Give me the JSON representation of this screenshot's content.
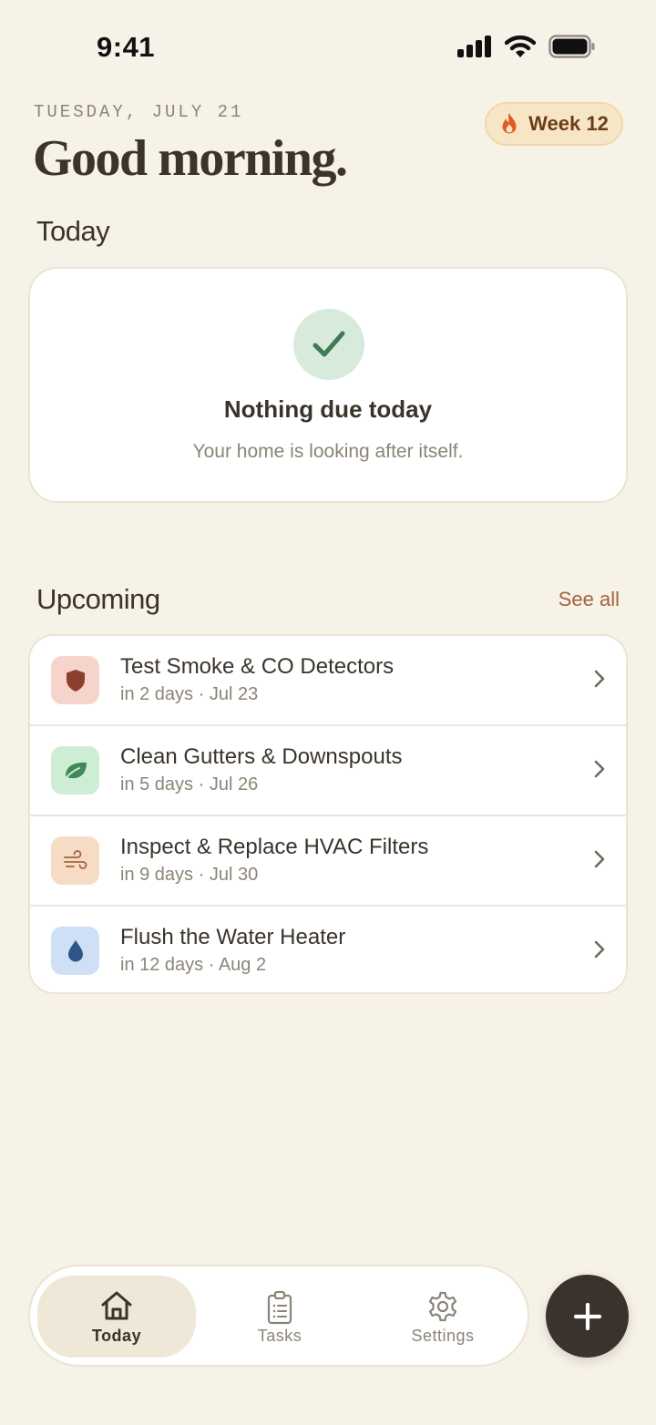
{
  "status_bar": {
    "time": "9:41"
  },
  "header": {
    "date": "TUESDAY, JULY 21",
    "greeting": "Good morning.",
    "streak_badge": {
      "label": "Week 12",
      "icon": "flame-icon"
    }
  },
  "today": {
    "title": "Today",
    "empty_headline": "Nothing due today",
    "empty_subtext": "Your home is looking after itself.",
    "icon": "check-icon"
  },
  "upcoming": {
    "title": "Upcoming",
    "see_all_label": "See all",
    "tasks": [
      {
        "title": "Test Smoke & CO Detectors",
        "due": "in 2 days · Jul 23",
        "icon": "shield-icon",
        "icon_bg": "#f6d4cc",
        "icon_color": "#8c3f2c"
      },
      {
        "title": "Clean Gutters & Downspouts",
        "due": "in 5 days · Jul 26",
        "icon": "leaf-icon",
        "icon_bg": "#cdeed4",
        "icon_color": "#3f8a57"
      },
      {
        "title": "Inspect & Replace HVAC Filters",
        "due": "in 9 days · Jul 30",
        "icon": "wind-icon",
        "icon_bg": "#f6dcc5",
        "icon_color": "#a2643c"
      },
      {
        "title": "Flush the Water Heater",
        "due": "in 12 days · Aug 2",
        "icon": "drop-icon",
        "icon_bg": "#cfe0f6",
        "icon_color": "#2f5687"
      }
    ]
  },
  "tab_bar": {
    "tabs": [
      {
        "label": "Today",
        "icon": "home-icon",
        "active": true
      },
      {
        "label": "Tasks",
        "icon": "clipboard-icon",
        "active": false
      },
      {
        "label": "Settings",
        "icon": "gear-icon",
        "active": false
      }
    ]
  },
  "fab": {
    "icon": "plus-icon"
  },
  "colors": {
    "background": "#f7f2e8",
    "accent": "#a2643c",
    "text": "#3a342b",
    "muted": "#8b8477",
    "fab": "#3b322b"
  }
}
